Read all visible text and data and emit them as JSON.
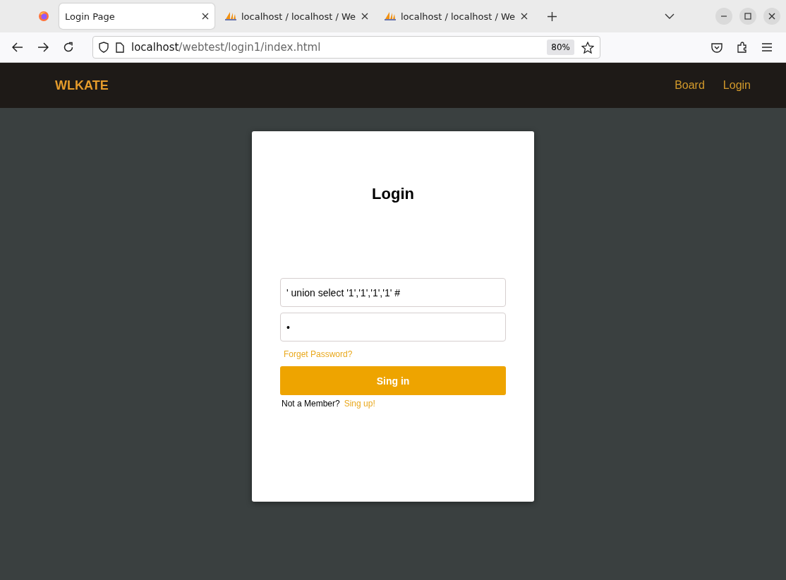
{
  "browser": {
    "tabs": [
      {
        "title": "Login Page",
        "selected": true,
        "kind": "page"
      },
      {
        "title": "localhost / localhost / We",
        "selected": false,
        "kind": "pma"
      },
      {
        "title": "localhost / localhost / We",
        "selected": false,
        "kind": "pma"
      }
    ],
    "url": {
      "host": "localhost",
      "path": "/webtest/login1/index.html"
    },
    "zoom": "80%"
  },
  "navbar": {
    "brand": "WLKATE",
    "links": [
      "Board",
      "Login"
    ]
  },
  "login": {
    "title": "Login",
    "username": "' union select '1','1','1','1' #",
    "password": "•",
    "forgot": "Forget Password?",
    "submit": "Sing in",
    "signup_prompt": "Not a Member?",
    "signup_link": "Sing up!"
  }
}
